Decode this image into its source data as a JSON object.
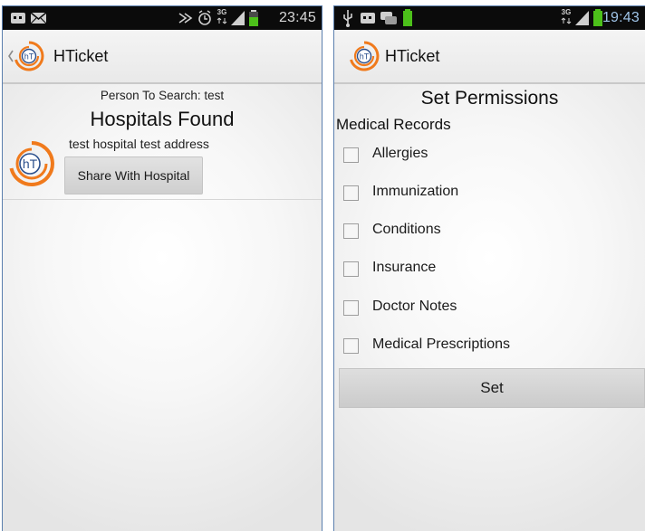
{
  "left_screen": {
    "status": {
      "time": "23:45",
      "network": "3G"
    },
    "action_bar": {
      "title": "HTicket",
      "logo_text": "hT"
    },
    "search_label": "Person To Search: test",
    "heading": "Hospitals Found",
    "hospital": {
      "name": "test hospital test address",
      "logo_text": "hT",
      "share_label": "Share With Hospital"
    }
  },
  "right_screen": {
    "status": {
      "time": "19:43",
      "network": "3G"
    },
    "action_bar": {
      "title": "HTicket",
      "logo_text": "hT"
    },
    "heading": "Set Permissions",
    "section_label": "Medical Records",
    "permissions": [
      {
        "label": "Allergies",
        "checked": false
      },
      {
        "label": "Immunization",
        "checked": false
      },
      {
        "label": "Conditions",
        "checked": false
      },
      {
        "label": "Insurance",
        "checked": false
      },
      {
        "label": "Doctor Notes",
        "checked": false
      },
      {
        "label": "Medical Prescriptions",
        "checked": false
      }
    ],
    "set_label": "Set"
  },
  "colors": {
    "logo_orange": "#f07a1c",
    "logo_blue": "#2b4f8c",
    "battery_green": "#4cc01a",
    "status_bar": "#0b0b0b",
    "frame_border": "#5b7fae"
  }
}
